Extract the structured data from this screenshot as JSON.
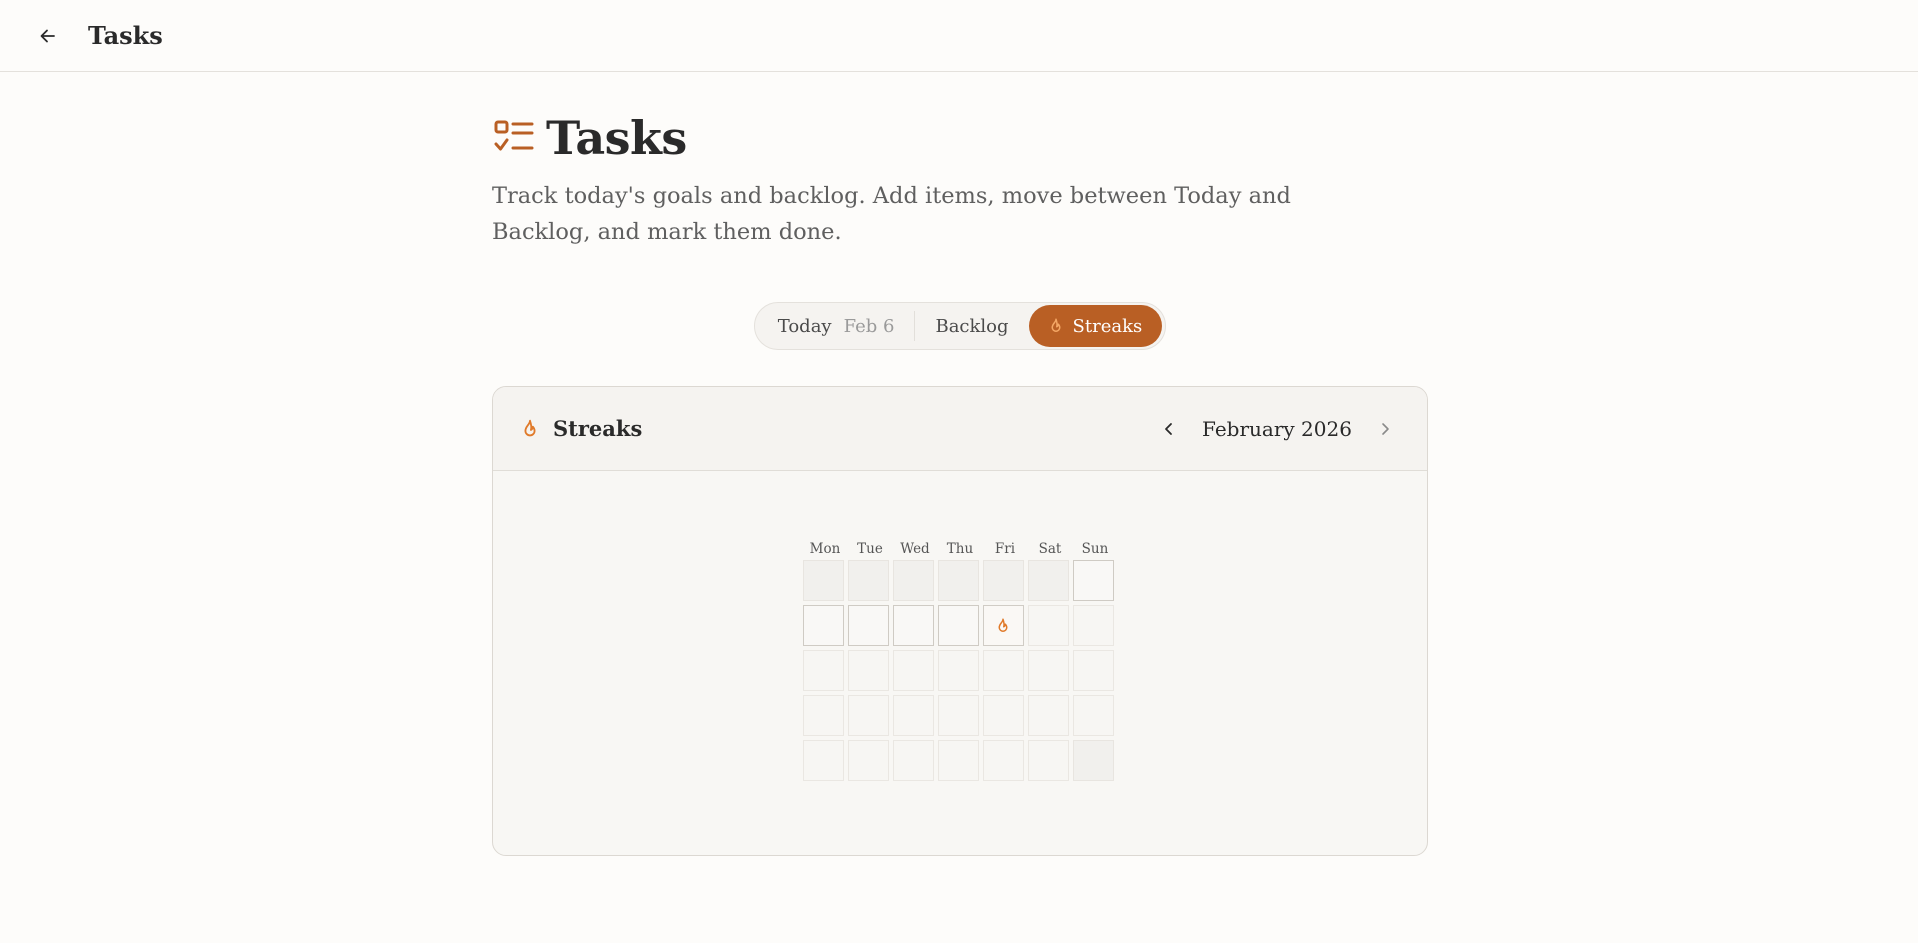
{
  "topbar": {
    "title": "Tasks",
    "back_icon": "arrow-left-icon"
  },
  "page": {
    "title": "Tasks",
    "title_icon": "checklist-icon",
    "description": "Track today's goals and backlog. Add items, move between Today and Backlog, and mark them done."
  },
  "tabs": {
    "today_label": "Today",
    "today_date": "Feb 6",
    "backlog_label": "Backlog",
    "streaks_label": "Streaks",
    "active": "Streaks"
  },
  "streaks": {
    "title": "Streaks",
    "month": "February 2026",
    "weekdays": [
      "Mon",
      "Tue",
      "Wed",
      "Thu",
      "Fri",
      "Sat",
      "Sun"
    ],
    "streak_days": [
      6
    ]
  },
  "colors": {
    "accent": "#b95f24",
    "flame": "#e07a2a"
  }
}
